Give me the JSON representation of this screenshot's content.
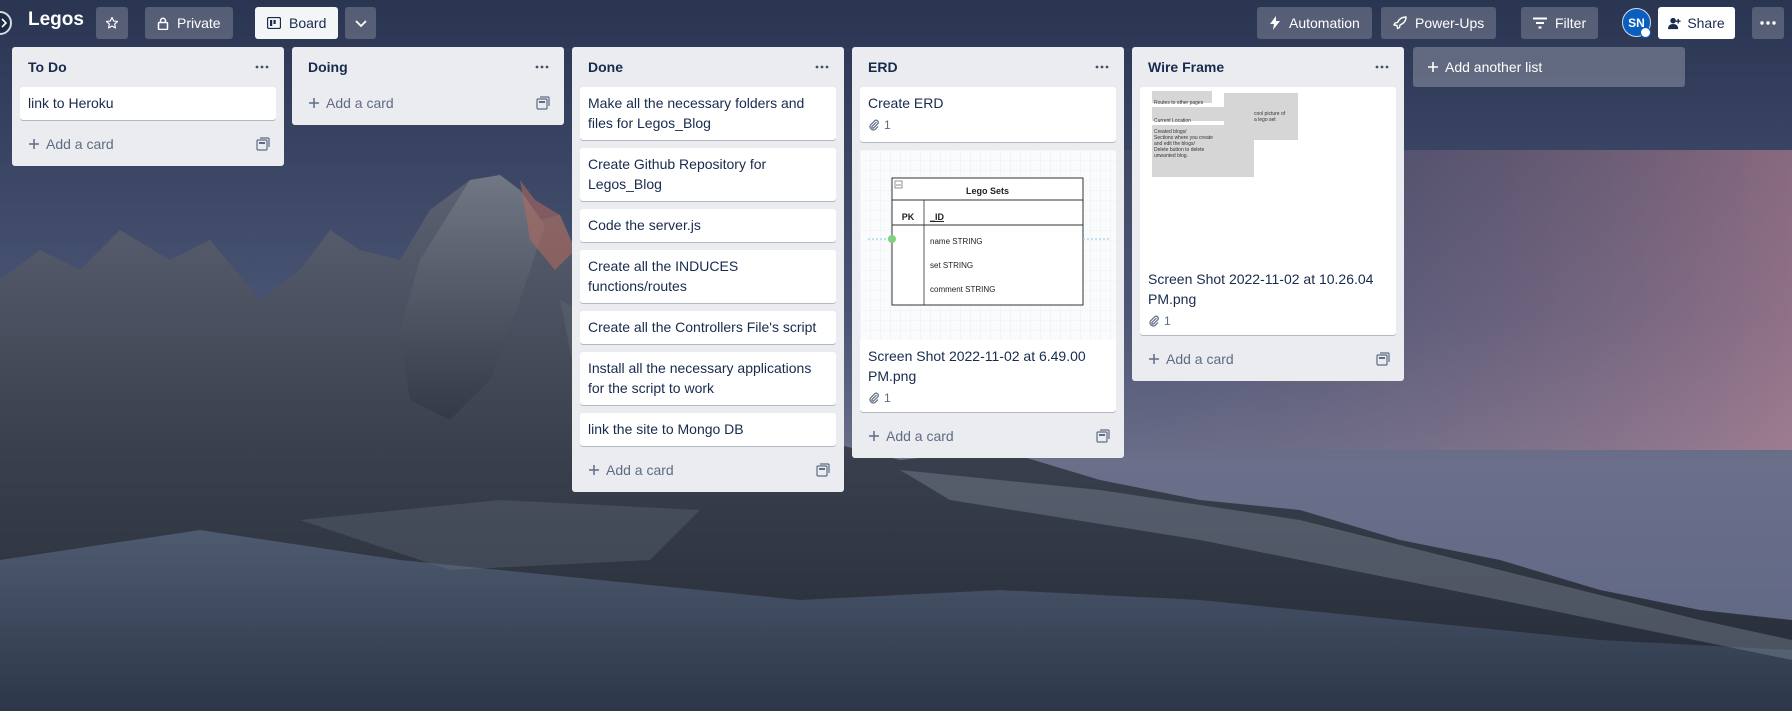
{
  "board": {
    "title": "Legos",
    "visibility_label": "Private",
    "view_label": "Board"
  },
  "header_right": {
    "automation_label": "Automation",
    "powerups_label": "Power-Ups",
    "filter_label": "Filter",
    "avatar_initials": "SN",
    "share_label": "Share"
  },
  "colors": {
    "list_bg": "#ebecf0",
    "card_bg": "#ffffff",
    "avatar_bg": "#0a5ec0",
    "text": "#172b4d",
    "muted": "#5e6c84"
  },
  "lists": [
    {
      "title": "To Do",
      "cards": [
        {
          "title": "link to Heroku"
        }
      ],
      "add_card_label": "Add a card"
    },
    {
      "title": "Doing",
      "cards": [],
      "add_card_label": "Add a card"
    },
    {
      "title": "Done",
      "cards": [
        {
          "title": "Make all the necessary folders and files for Legos_Blog"
        },
        {
          "title": "Create Github Repository for Legos_Blog"
        },
        {
          "title": "Code the server.js"
        },
        {
          "title": "Create all the INDUCES functions/routes"
        },
        {
          "title": "Create all the Controllers File's script"
        },
        {
          "title": "Install all the necessary applications for the script to work"
        },
        {
          "title": "link the site to Mongo DB"
        }
      ],
      "add_card_label": "Add a card"
    },
    {
      "title": "ERD",
      "cards": [
        {
          "title": "Create ERD",
          "attachments": "1"
        },
        {
          "title": "Screen Shot 2022-11-02 at 6.49.00 PM.png",
          "attachments": "1",
          "cover": {
            "table_title": "Lego Sets",
            "pk_label": "PK",
            "id_label": "_ID",
            "fields": [
              "name STRING",
              "set STRING",
              "comment STRING"
            ]
          }
        }
      ],
      "add_card_label": "Add a card"
    },
    {
      "title": "Wire Frame",
      "cards": [
        {
          "title": "Screen Shot 2022-11-02 at 10.26.04 PM.png",
          "attachments": "1",
          "cover": {
            "note_routes": "Routes to other pages",
            "note_location": "Current Location",
            "note_blogs": [
              "Created blogs/",
              "Sections where you create",
              "and edit the blogs/",
              "Delete button to delete",
              "unwanted blog."
            ],
            "note_picture": [
              "cool picture of",
              "a lego set"
            ]
          }
        }
      ],
      "add_card_label": "Add a card"
    }
  ],
  "add_list_label": "Add another list",
  "icons": {
    "star": "star-icon",
    "lock": "lock-icon",
    "board": "board-icon",
    "chevron": "chevron-down-icon",
    "automation": "lightning-icon",
    "powerups": "rocket-icon",
    "filter": "filter-icon",
    "share": "add-person-icon",
    "more": "ellipsis-icon",
    "attachment": "paperclip-icon",
    "template": "template-icon",
    "plus": "plus-icon"
  }
}
